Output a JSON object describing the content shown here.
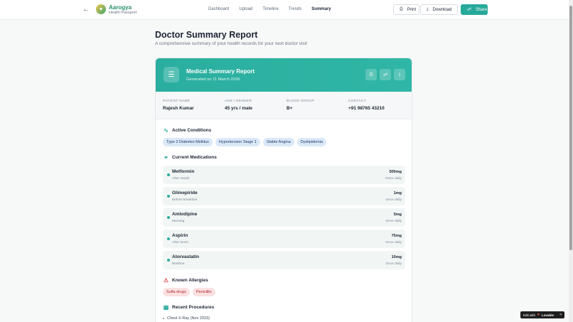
{
  "header": {
    "brand_name": "Aarogya",
    "brand_sub": "Health Passport",
    "nav": [
      "Dashboard",
      "Upload",
      "Timeline",
      "Trends",
      "Summary"
    ],
    "active_nav": "Summary",
    "print_label": "Print",
    "download_label": "Download",
    "share_label": "Share"
  },
  "page": {
    "title": "Doctor Summary Report",
    "subtitle": "A comprehensive summary of your health records for your next doctor visit"
  },
  "card": {
    "title": "Medical Summary Report",
    "generated": "Generated on 11 March 2026"
  },
  "patient": {
    "name_label": "PATIENT NAME",
    "name": "Rajesh Kumar",
    "age_label": "AGE / GENDER",
    "age": "45 yrs / male",
    "blood_label": "BLOOD GROUP",
    "blood": "B+",
    "contact_label": "CONTACT",
    "contact": "+91 98765 43210"
  },
  "conditions": {
    "title": "Active Conditions",
    "items": [
      "Type 2 Diabetes Mellitus",
      "Hypertension Stage 1",
      "Stable Angina",
      "Dyslipidemia"
    ]
  },
  "medications": {
    "title": "Current Medications",
    "items": [
      {
        "name": "Metformin",
        "note": "After meals",
        "dose": "500mg",
        "freq": "Twice daily"
      },
      {
        "name": "Glimepiride",
        "note": "Before breakfast",
        "dose": "1mg",
        "freq": "Once daily"
      },
      {
        "name": "Amlodipine",
        "note": "Morning",
        "dose": "5mg",
        "freq": "Once daily"
      },
      {
        "name": "Aspirin",
        "note": "After lunch",
        "dose": "75mg",
        "freq": "Once daily"
      },
      {
        "name": "Atorvastatin",
        "note": "Bedtime",
        "dose": "10mg",
        "freq": "Once daily"
      }
    ]
  },
  "allergies": {
    "title": "Known Allergies",
    "items": [
      "Sulfa drugs",
      "Penicillin"
    ]
  },
  "procedures": {
    "title": "Recent Procedures",
    "items": [
      "Chest X-Ray (Nov 2023)"
    ]
  },
  "badge": {
    "edit_with": "Edit with",
    "brand": "Lovable"
  },
  "colors": {
    "accent": "#2aae9f",
    "allergy": "#e14d4d"
  }
}
